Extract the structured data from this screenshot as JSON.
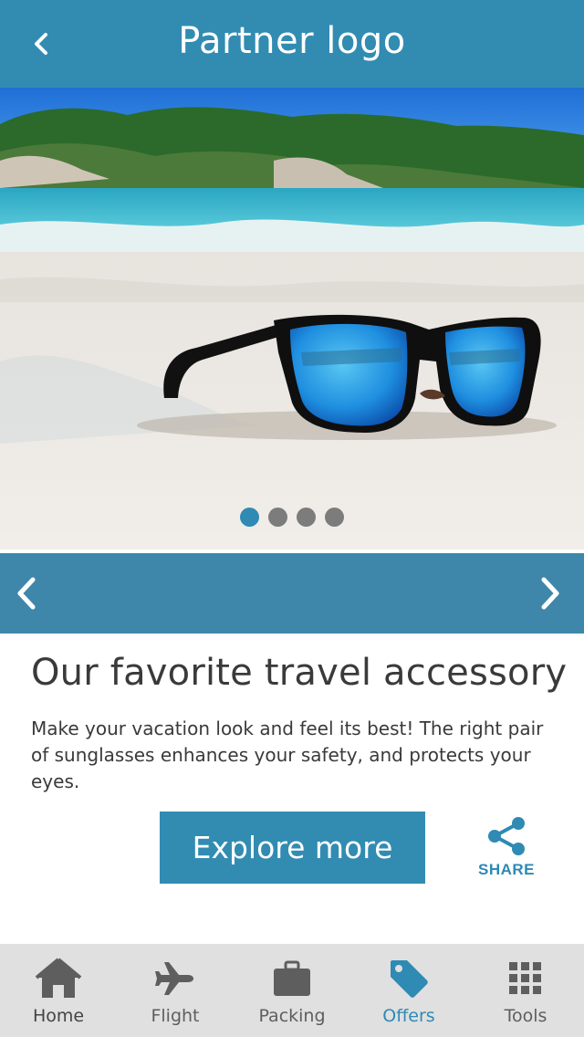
{
  "header": {
    "title": "Partner logo",
    "back_icon": "chevron-left-icon"
  },
  "carousel": {
    "slide_count": 4,
    "active_slide": 1,
    "prev_icon": "chevron-left-icon",
    "next_icon": "chevron-right-icon"
  },
  "offer": {
    "headline": "Our favorite travel accessory",
    "description": "Make your vacation look and feel its best! The right pair of sunglasses enhances your safety, and protects your eyes.",
    "cta_label": "Explore more",
    "share_label": "SHARE"
  },
  "tabs": [
    {
      "label": "Home",
      "icon": "home-icon",
      "active": false
    },
    {
      "label": "Flight",
      "icon": "airplane-icon",
      "active": false
    },
    {
      "label": "Packing",
      "icon": "briefcase-icon",
      "active": false
    },
    {
      "label": "Offers",
      "icon": "tag-icon",
      "active": true
    },
    {
      "label": "Tools",
      "icon": "grid-icon",
      "active": false
    }
  ],
  "colors": {
    "brand": "#328cb2",
    "nav_bar": "#3e87ab",
    "tab_bar": "#e0e0e0",
    "active": "#2f8ab4",
    "inactive_icon": "#5e5e5e"
  }
}
